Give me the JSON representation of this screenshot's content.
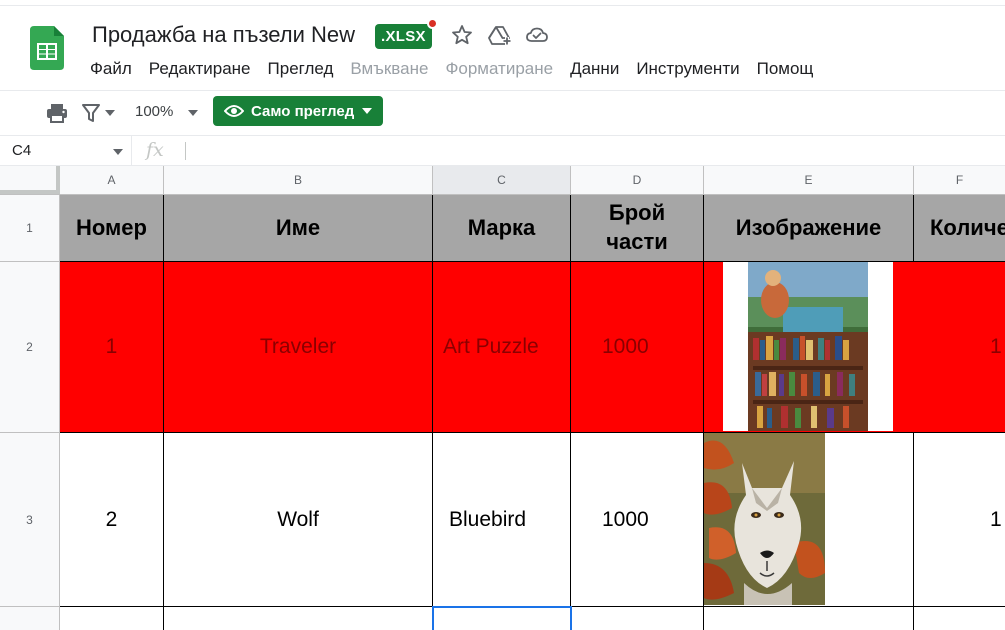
{
  "document": {
    "title": "Продажба на пъзели New",
    "format_badge": ".XLSX"
  },
  "menu": [
    "Файл",
    "Редактиране",
    "Преглед",
    "Вмъкване",
    "Форматиране",
    "Данни",
    "Инструменти",
    "Помощ"
  ],
  "menu_disabled": [
    "Вмъкване",
    "Форматиране"
  ],
  "toolbar": {
    "zoom": "100%",
    "view_only_label": "Само преглед"
  },
  "formula_bar": {
    "name_box": "C4",
    "fx_label": "fx"
  },
  "grid": {
    "columns": [
      "A",
      "B",
      "C",
      "D",
      "E",
      "F"
    ],
    "selected_column": "C",
    "rows": [
      "1",
      "2",
      "3"
    ],
    "header_row": [
      "Номер",
      "Име",
      "Марка",
      "Брой части",
      "Изображение",
      "Количе"
    ],
    "data_rows": [
      {
        "number": "1",
        "name": "Traveler",
        "brand": "Art Puzzle",
        "pieces": "1000",
        "image": "traveler-puzzle-image",
        "quantity": "1",
        "highlight": "#ff0000"
      },
      {
        "number": "2",
        "name": "Wolf",
        "brand": "Bluebird",
        "pieces": "1000",
        "image": "wolf-puzzle-image",
        "quantity": "1",
        "highlight": "#ffffff"
      }
    ]
  },
  "colors": {
    "brand_green": "#188038",
    "header_fill": "#a6a6a6",
    "row_highlight": "#ff0000",
    "selection": "#1a73e8"
  }
}
